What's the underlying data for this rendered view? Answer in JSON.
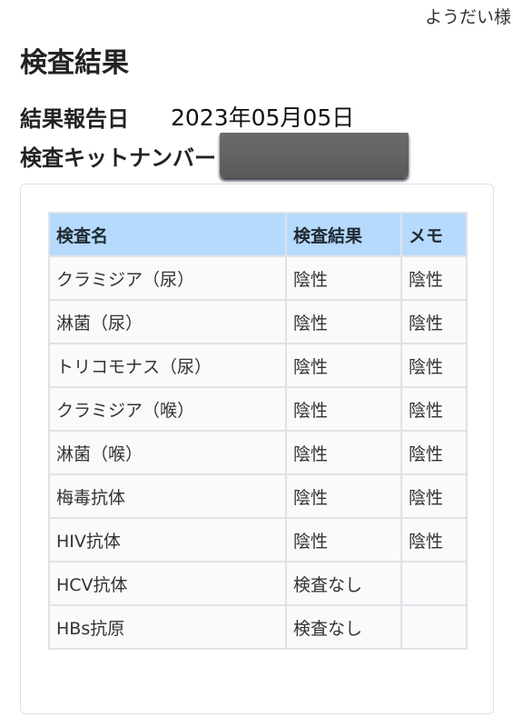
{
  "header": {
    "user_name": "ようだい様",
    "page_title": "検査結果"
  },
  "info": {
    "report_date_label": "結果報告日",
    "report_date_value": "2023年05月05日",
    "kit_number_label": "検査キットナンバー",
    "kit_number_value": ""
  },
  "table": {
    "headers": [
      "検査名",
      "検査結果",
      "メモ"
    ],
    "rows": [
      {
        "name": "クラミジア（尿）",
        "result": "陰性",
        "memo": "陰性"
      },
      {
        "name": "淋菌（尿）",
        "result": "陰性",
        "memo": "陰性"
      },
      {
        "name": "トリコモナス（尿）",
        "result": "陰性",
        "memo": "陰性"
      },
      {
        "name": "クラミジア（喉）",
        "result": "陰性",
        "memo": "陰性"
      },
      {
        "name": "淋菌（喉）",
        "result": "陰性",
        "memo": "陰性"
      },
      {
        "name": "梅毒抗体",
        "result": "陰性",
        "memo": "陰性"
      },
      {
        "name": "HIV抗体",
        "result": "陰性",
        "memo": "陰性"
      },
      {
        "name": "HCV抗体",
        "result": "検査なし",
        "memo": ""
      },
      {
        "name": "HBs抗原",
        "result": "検査なし",
        "memo": ""
      }
    ]
  },
  "colors": {
    "header_bg": "#b6dafc",
    "cell_bg": "#fafafa",
    "border": "#dfe3e8",
    "redaction": "#666668"
  }
}
